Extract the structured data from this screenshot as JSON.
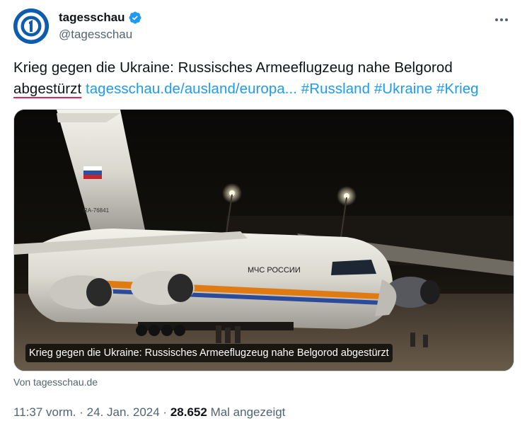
{
  "author": {
    "display_name": "tagesschau",
    "handle": "@tagesschau",
    "avatar_icon": "tagesschau-logo-icon",
    "verified_icon": "verified-badge-icon",
    "verified_color": "#1d9bf0"
  },
  "more_icon": "more-options-icon",
  "tweet": {
    "text_main": "Krieg gegen die Ukraine: Russisches Armeeflugzeug nahe Belgorod ",
    "text_underlined": "abgestürzt",
    "link": "tagesschau.de/ausland/europa...",
    "hashtags": [
      "#Russland",
      "#Ukraine",
      "#Krieg"
    ]
  },
  "card": {
    "caption": "Krieg gegen die Ukraine: Russisches Armeeflugzeug nahe Belgorod abgestürzt",
    "source": "Von tagesschau.de",
    "aircraft_registration": "RA-76841",
    "aircraft_marking": "МЧС РОССИИ"
  },
  "meta": {
    "time": "11:37 vorm.",
    "separator": "·",
    "date": "24. Jan. 2024",
    "views_count": "28.652",
    "views_label": "Mal angezeigt"
  },
  "colors": {
    "link": "#1d9bf0",
    "secondary_text": "#536471",
    "primary_text": "#0f1419",
    "spellcheck_underline": "#e0245e"
  }
}
